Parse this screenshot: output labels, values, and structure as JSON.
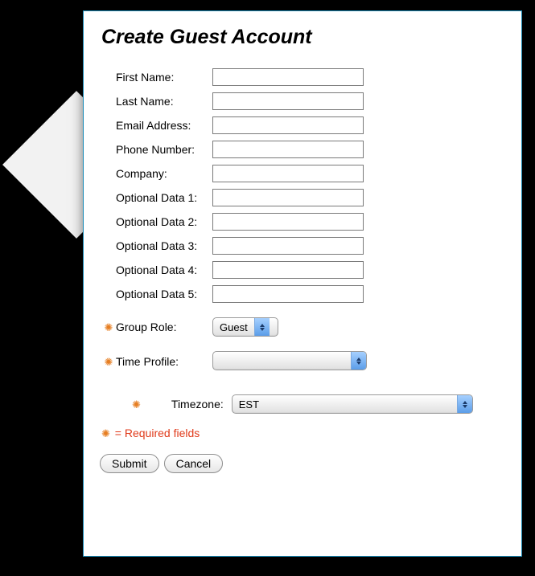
{
  "title": "Create Guest Account",
  "fields": {
    "first_name": {
      "label": "First Name:",
      "value": ""
    },
    "last_name": {
      "label": "Last Name:",
      "value": ""
    },
    "email": {
      "label": "Email Address:",
      "value": ""
    },
    "phone": {
      "label": "Phone Number:",
      "value": ""
    },
    "company": {
      "label": "Company:",
      "value": ""
    },
    "opt1": {
      "label": "Optional Data 1:",
      "value": ""
    },
    "opt2": {
      "label": "Optional Data 2:",
      "value": ""
    },
    "opt3": {
      "label": "Optional Data 3:",
      "value": ""
    },
    "opt4": {
      "label": "Optional Data 4:",
      "value": ""
    },
    "opt5": {
      "label": "Optional Data 5:",
      "value": ""
    }
  },
  "group_role": {
    "label": "Group Role:",
    "selected": "Guest"
  },
  "time_profile": {
    "label": "Time Profile:",
    "selected": ""
  },
  "timezone": {
    "label": "Timezone:",
    "selected": "EST"
  },
  "legend_text": "= Required fields",
  "buttons": {
    "submit": "Submit",
    "cancel": "Cancel"
  },
  "icons": {
    "required_glyph": "✺"
  },
  "colors": {
    "panel_border": "#1a8bb8",
    "required_icon": "#e67e22",
    "required_text": "#e03a1a"
  }
}
